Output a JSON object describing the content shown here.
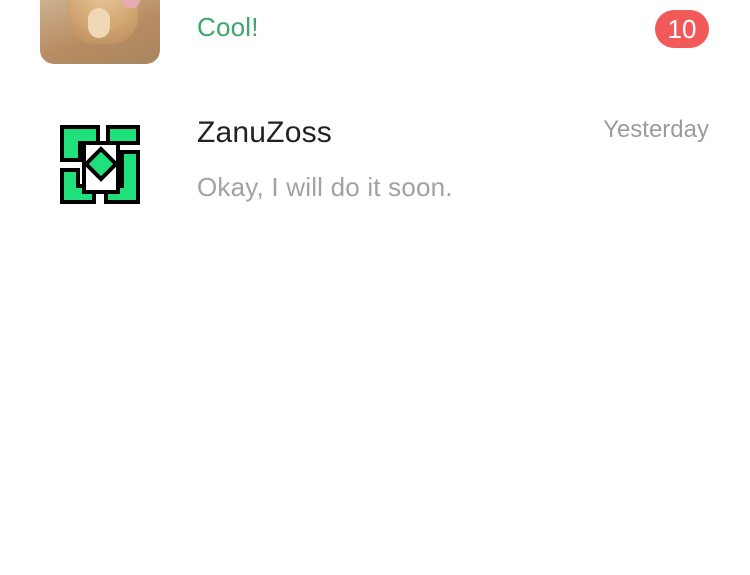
{
  "chats": [
    {
      "avatar": "cat-photo-avatar",
      "preview": "Cool!",
      "unread_count": "10",
      "preview_color": "#3da66b"
    },
    {
      "avatar": "zanuzoss-logo-avatar",
      "name": "ZanuZoss",
      "time": "Yesterday",
      "preview": "Okay, I will do it soon.",
      "preview_color": "#a2a2a2"
    }
  ],
  "colors": {
    "badge": "#f25a5a",
    "accent_green": "#3da66b",
    "logo_green": "#1fe07a"
  }
}
